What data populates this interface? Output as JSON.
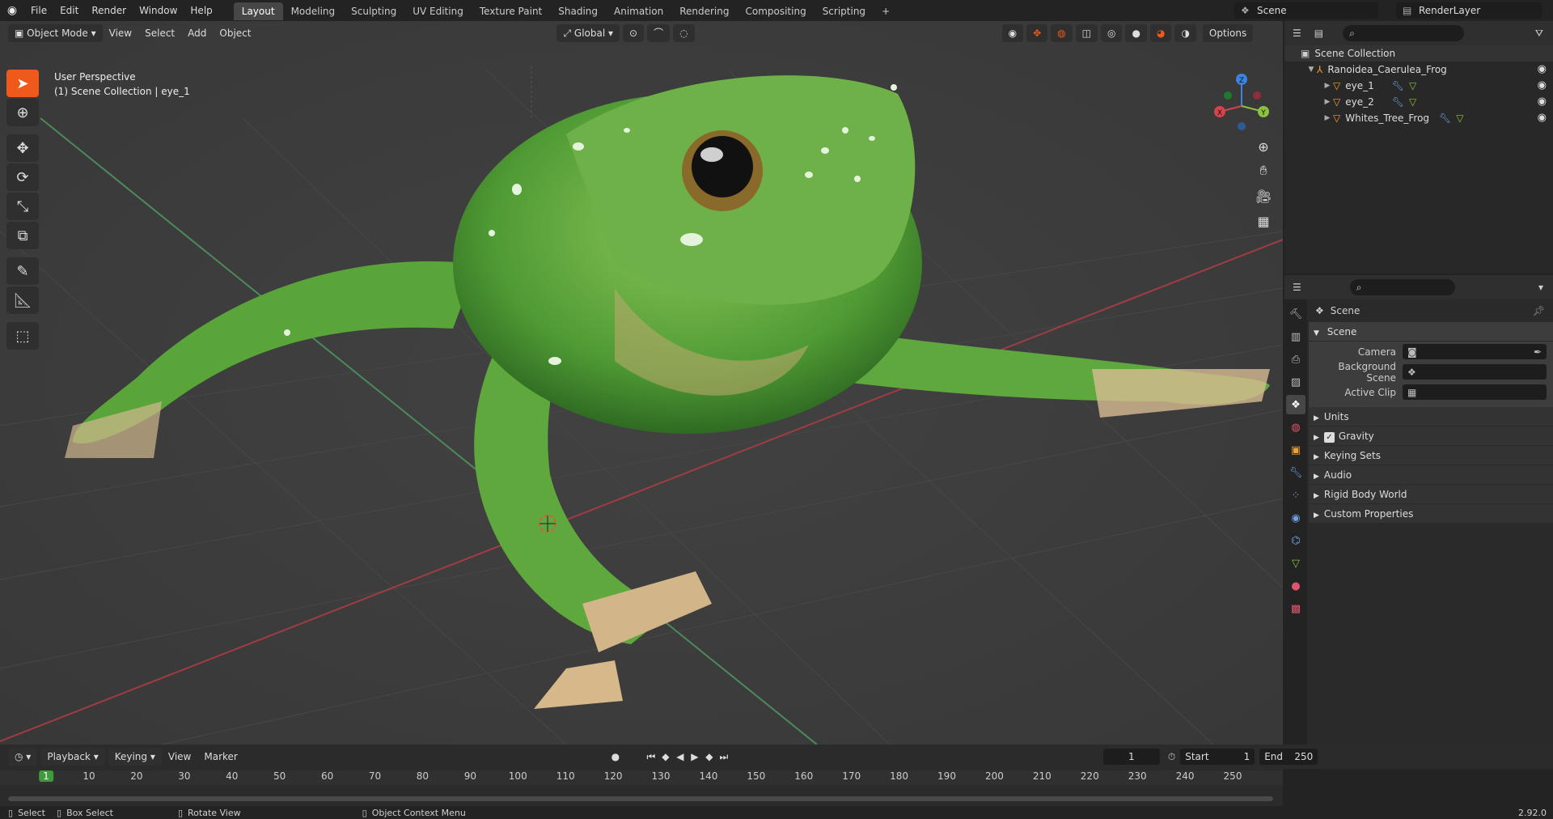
{
  "topbar": {
    "menu": [
      "File",
      "Edit",
      "Render",
      "Window",
      "Help"
    ],
    "workspaces": [
      "Layout",
      "Modeling",
      "Sculpting",
      "UV Editing",
      "Texture Paint",
      "Shading",
      "Animation",
      "Rendering",
      "Compositing",
      "Scripting"
    ],
    "active_workspace": "Layout",
    "add_workspace": "+",
    "scene_name": "Scene",
    "render_layer": "RenderLayer"
  },
  "viewport": {
    "mode": "Object Mode",
    "menus": [
      "View",
      "Select",
      "Add",
      "Object"
    ],
    "orientation": "Global",
    "options": "Options",
    "info_line1": "User Perspective",
    "info_line2": "(1) Scene Collection | eye_1",
    "gizmo": {
      "x": "X",
      "y": "Y",
      "z": "Z"
    },
    "model": "tree frog (3D render)"
  },
  "outliner": {
    "root": "Scene Collection",
    "items": [
      {
        "label": "Ranoidea_Caerulea_Frog",
        "level": 1,
        "icon": "armature-icon"
      },
      {
        "label": "eye_1",
        "level": 2,
        "icon": "mesh-icon"
      },
      {
        "label": "eye_2",
        "level": 2,
        "icon": "mesh-icon"
      },
      {
        "label": "Whites_Tree_Frog",
        "level": 2,
        "icon": "mesh-icon"
      }
    ]
  },
  "properties": {
    "context": "Scene",
    "section": "Scene",
    "fields": [
      {
        "label": "Camera",
        "value": ""
      },
      {
        "label": "Background Scene",
        "value": ""
      },
      {
        "label": "Active Clip",
        "value": ""
      }
    ],
    "subsections": [
      "Units",
      "Gravity",
      "Keying Sets",
      "Audio",
      "Rigid Body World",
      "Custom Properties"
    ],
    "gravity_checked": true
  },
  "timeline": {
    "menus": [
      "Playback",
      "Keying",
      "View",
      "Marker"
    ],
    "current_frame": "1",
    "start_label": "Start",
    "start": "1",
    "end_label": "End",
    "end": "250",
    "ticks": [
      "1",
      "10",
      "20",
      "30",
      "40",
      "50",
      "60",
      "70",
      "80",
      "90",
      "100",
      "110",
      "120",
      "130",
      "140",
      "150",
      "160",
      "170",
      "180",
      "190",
      "200",
      "210",
      "220",
      "230",
      "240",
      "250"
    ]
  },
  "statusbar": {
    "select": "Select",
    "box_select": "Box Select",
    "rotate": "Rotate View",
    "context_menu": "Object Context Menu",
    "version": "2.92.0"
  },
  "colors": {
    "accent": "#ef5a1c",
    "frog_green": "#5aa53a",
    "x_axis": "#d9434c",
    "y_axis": "#8bc13b",
    "z_axis": "#3b84e0"
  }
}
